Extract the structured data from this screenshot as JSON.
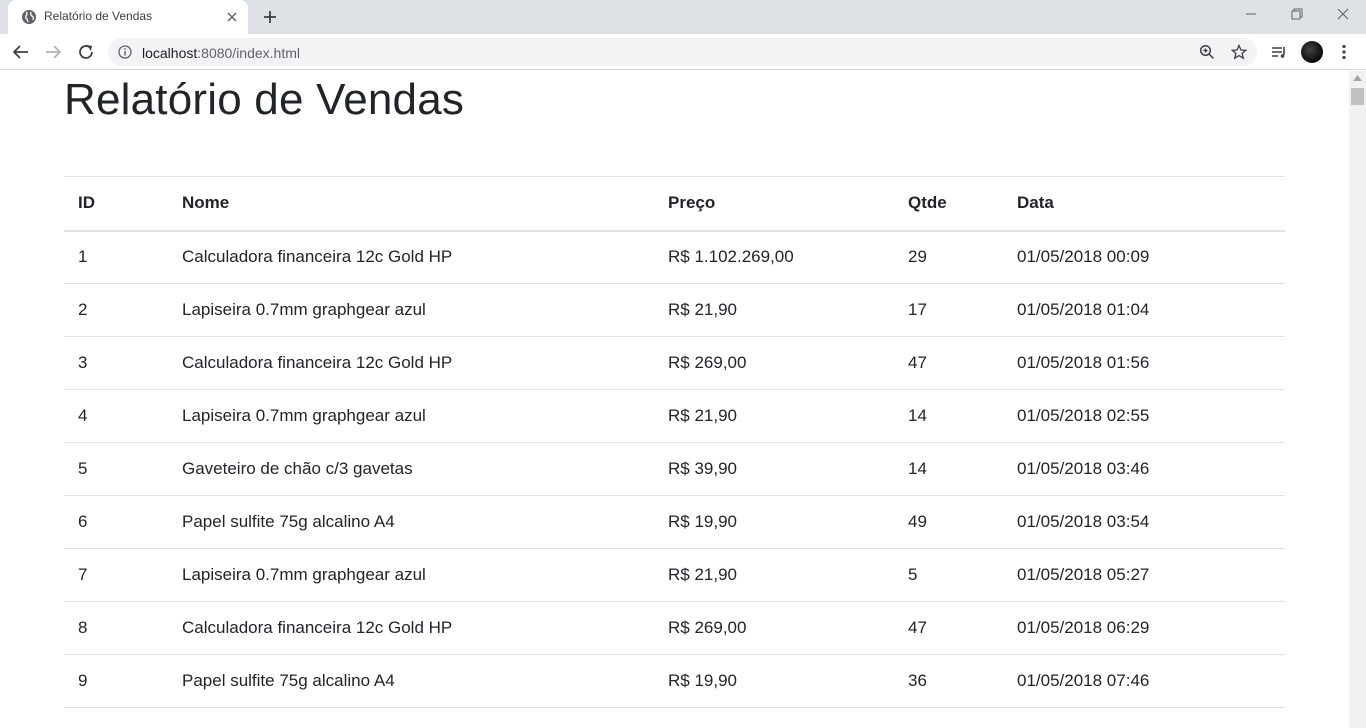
{
  "browser": {
    "tab_title": "Relatório de Vendas",
    "url_host": "localhost",
    "url_rest": ":8080/index.html"
  },
  "page": {
    "title": "Relatório de Vendas"
  },
  "table": {
    "headers": [
      "ID",
      "Nome",
      "Preço",
      "Qtde",
      "Data"
    ],
    "rows": [
      [
        "1",
        "Calculadora financeira 12c Gold HP",
        "R$ 1.102.269,00",
        "29",
        "01/05/2018 00:09"
      ],
      [
        "2",
        "Lapiseira 0.7mm graphgear azul",
        "R$ 21,90",
        "17",
        "01/05/2018 01:04"
      ],
      [
        "3",
        "Calculadora financeira 12c Gold HP",
        "R$ 269,00",
        "47",
        "01/05/2018 01:56"
      ],
      [
        "4",
        "Lapiseira 0.7mm graphgear azul",
        "R$ 21,90",
        "14",
        "01/05/2018 02:55"
      ],
      [
        "5",
        "Gaveteiro de chão c/3 gavetas",
        "R$ 39,90",
        "14",
        "01/05/2018 03:46"
      ],
      [
        "6",
        "Papel sulfite 75g alcalino A4",
        "R$ 19,90",
        "49",
        "01/05/2018 03:54"
      ],
      [
        "7",
        "Lapiseira 0.7mm graphgear azul",
        "R$ 21,90",
        "5",
        "01/05/2018 05:27"
      ],
      [
        "8",
        "Calculadora financeira 12c Gold HP",
        "R$ 269,00",
        "47",
        "01/05/2018 06:29"
      ],
      [
        "9",
        "Papel sulfite 75g alcalino A4",
        "R$ 19,90",
        "36",
        "01/05/2018 07:46"
      ]
    ]
  }
}
